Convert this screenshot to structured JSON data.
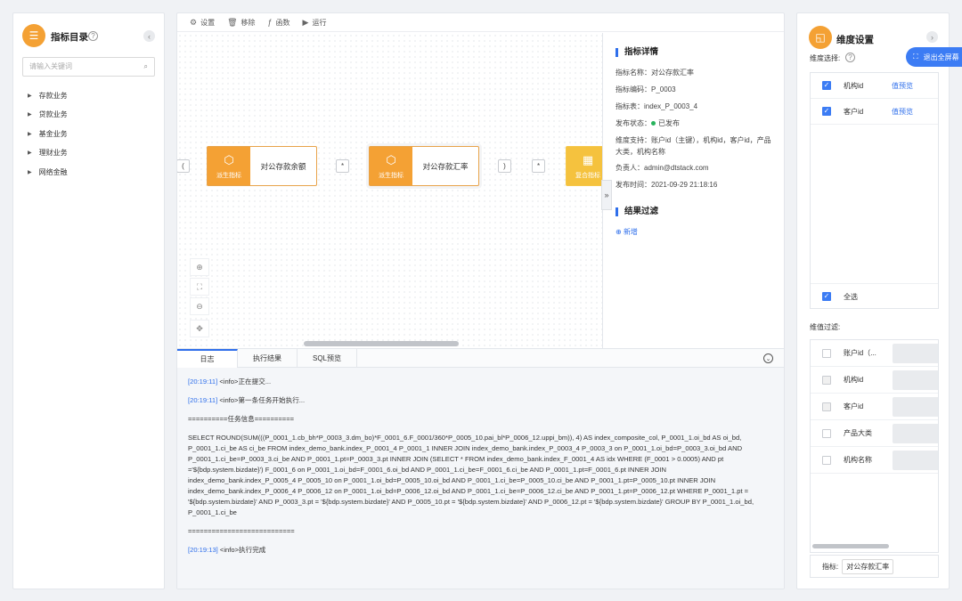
{
  "left": {
    "title": "指标目录",
    "search_placeholder": "请输入关键词",
    "tree": [
      "存款业务",
      "贷款业务",
      "基金业务",
      "理财业务",
      "网络金融"
    ]
  },
  "toolbar": {
    "items": [
      "设置",
      "移除",
      "函数",
      "运行"
    ]
  },
  "canvas": {
    "open_paren": "(",
    "close_paren": ")",
    "op_mul_1": "*",
    "op_mul_2": "*",
    "node1": {
      "label": "对公存款余额",
      "type": "派生指标"
    },
    "node2": {
      "label": "对公存款汇率",
      "type": "派生指标"
    },
    "node3": {
      "type": "复合指标"
    }
  },
  "detail": {
    "title": "指标详情",
    "rows": [
      "指标名称：对公存款汇率",
      "指标编码：P_0003",
      "指标表：index_P_0003_4",
      "发布状态：",
      "维度支持：账户id（主键），机构id，客户id，产品大类，机构名称",
      "负责人：admin@dtstack.com",
      "发布时间：2021-09-29 21:18:16"
    ],
    "status": "已发布",
    "filter_title": "结果过滤",
    "add": "新增"
  },
  "tabs": [
    "日志",
    "执行结果",
    "SQL预览"
  ],
  "log": {
    "l1_time": "[20:19:11]",
    "l1_text": " <info>正在提交...",
    "l2_time": "[20:19:11]",
    "l2_text": " <info>第一条任务开始执行...",
    "l3": "==========任务信息==========",
    "sql": "SELECT ROUND(SUM(((P_0001_1.cb_bh*P_0003_3.dm_bo)*F_0001_6.F_0001/360*P_0005_10.pai_bl*P_0006_12.uppi_bm)), 4) AS index_composite_col, P_0001_1.oi_bd AS oi_bd, P_0001_1.ci_be AS ci_be FROM index_demo_bank.index_P_0001_4 P_0001_1 INNER JOIN index_demo_bank.index_P_0003_4 P_0003_3 on P_0001_1.oi_bd=P_0003_3.oi_bd AND P_0001_1.ci_be=P_0003_3.ci_be AND P_0001_1.pt=P_0003_3.pt INNER JOIN (SELECT * FROM index_demo_bank.index_F_0001_4 AS idx WHERE (F_0001 > 0.0005) AND pt ='${bdp.system.bizdate}') F_0001_6 on P_0001_1.oi_bd=F_0001_6.oi_bd AND P_0001_1.ci_be=F_0001_6.ci_be AND P_0001_1.pt=F_0001_6.pt INNER JOIN index_demo_bank.index_P_0005_4 P_0005_10 on P_0001_1.oi_bd=P_0005_10.oi_bd AND P_0001_1.ci_be=P_0005_10.ci_be AND P_0001_1.pt=P_0005_10.pt INNER JOIN index_demo_bank.index_P_0006_4 P_0006_12 on P_0001_1.oi_bd=P_0006_12.oi_bd AND P_0001_1.ci_be=P_0006_12.ci_be AND P_0001_1.pt=P_0006_12.pt WHERE P_0001_1.pt = '${bdp.system.bizdate}' AND P_0003_3.pt = '${bdp.system.bizdate}' AND P_0005_10.pt = '${bdp.system.bizdate}' AND P_0006_12.pt = '${bdp.system.bizdate}' GROUP BY P_0001_1.oi_bd, P_0001_1.ci_be",
    "l5": "===========================",
    "l6_time": "[20:19:13]",
    "l6_text": " <info>执行完成"
  },
  "right": {
    "title": "维度设置",
    "exit_fullscreen": "退出全屏幕",
    "dim_select_label": "维度选择:",
    "dims": [
      {
        "name": "机构id",
        "preview": "值预览"
      },
      {
        "name": "客户id",
        "preview": "值预览"
      }
    ],
    "select_all": "全选",
    "filter_label": "维值过滤:",
    "filters": [
      "账户id（...",
      "机构id",
      "客户id",
      "产品大类",
      "机构名称"
    ],
    "metric_label": "指标:",
    "metric_value": "对公存款汇率"
  },
  "colors": {
    "accent": "#2f6feb",
    "orange": "#f4a134",
    "success": "#27b35c"
  }
}
